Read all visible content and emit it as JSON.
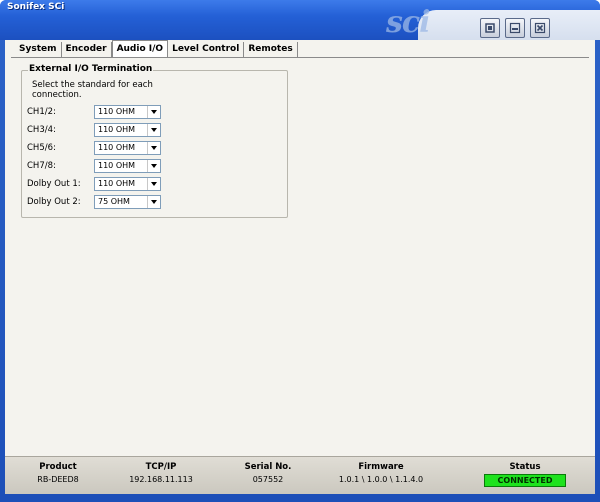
{
  "window": {
    "title": "Sonifex SCi",
    "logo_text": "sci"
  },
  "titlebar_buttons": [
    {
      "name": "restore-button",
      "icon": "restore-icon"
    },
    {
      "name": "minimize-button",
      "icon": "minimize-icon"
    },
    {
      "name": "close-button",
      "icon": "close-icon"
    }
  ],
  "tabs": [
    {
      "label": "System",
      "active": false
    },
    {
      "label": "Encoder",
      "active": false
    },
    {
      "label": "Audio I/O",
      "active": true
    },
    {
      "label": "Level Control",
      "active": false
    },
    {
      "label": "Remotes",
      "active": false
    }
  ],
  "termination": {
    "group_title": "External I/O Termination",
    "instruction": "Select the standard for each connection.",
    "rows": [
      {
        "label": "CH1/2:",
        "value": "110 OHM"
      },
      {
        "label": "CH3/4:",
        "value": "110 OHM"
      },
      {
        "label": "CH5/6:",
        "value": "110 OHM"
      },
      {
        "label": "CH7/8:",
        "value": "110 OHM"
      },
      {
        "label": "Dolby Out 1:",
        "value": "110 OHM"
      },
      {
        "label": "Dolby Out 2:",
        "value": "75 OHM"
      }
    ]
  },
  "statusbar": {
    "product": {
      "heading": "Product",
      "value": "RB-DEED8"
    },
    "tcpip": {
      "heading": "TCP/IP",
      "value": "192.168.11.113"
    },
    "serial": {
      "heading": "Serial No.",
      "value": "057552"
    },
    "firmware": {
      "heading": "Firmware",
      "value": "1.0.1 \\ 1.0.0 \\ 1.1.4.0"
    },
    "status": {
      "heading": "Status",
      "value": "CONNECTED",
      "color": "#1ee21e"
    }
  }
}
